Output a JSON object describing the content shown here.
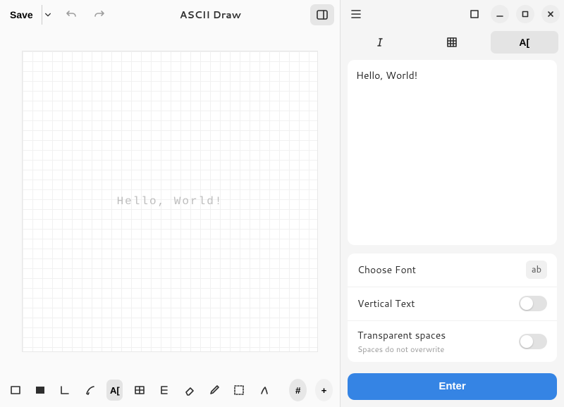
{
  "header": {
    "app_title": "ASCII Draw",
    "save_label": "Save"
  },
  "canvas": {
    "text": "Hello, World!"
  },
  "toolbar": {
    "char_label": "#",
    "plus_label": "+",
    "text_label": "A["
  },
  "panel": {
    "text_label": "A[",
    "text_value": "Hello, World!",
    "choose_font_label": "Choose Font",
    "font_chip": "ab",
    "vertical_label": "Vertical Text",
    "transparent_label": "Transparent spaces",
    "transparent_hint": "Spaces do not overwrite",
    "enter_label": "Enter"
  }
}
